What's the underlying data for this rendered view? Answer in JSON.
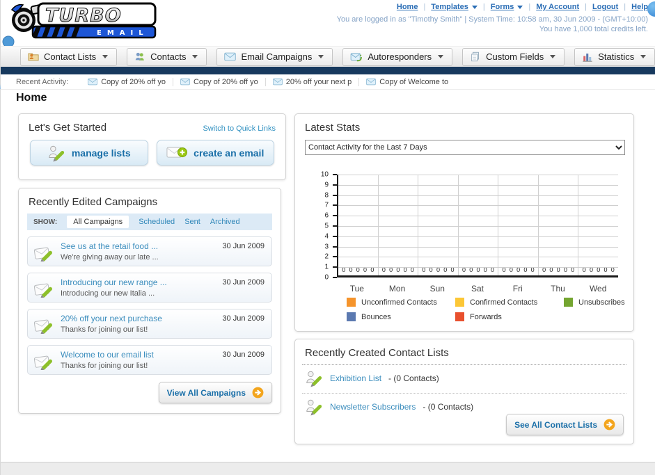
{
  "header": {
    "logo": {
      "title": "TURBO",
      "subtitle": "EMAIL"
    },
    "nav_links": [
      {
        "label": "Home"
      },
      {
        "label": "Templates",
        "dropdown": true
      },
      {
        "label": "Forms",
        "dropdown": true
      },
      {
        "label": "My Account"
      },
      {
        "label": "Logout"
      },
      {
        "label": "Help"
      }
    ],
    "login_info": "You are logged in as \"Timothy Smith\" | System Time: 10:58 am, 30 Jun 2009 - (GMT+10:00)",
    "credits_info": "You have 1,000 total credits left."
  },
  "nav_tabs": [
    {
      "label": "Contact Lists"
    },
    {
      "label": "Contacts"
    },
    {
      "label": "Email Campaigns"
    },
    {
      "label": "Autoresponders"
    },
    {
      "label": "Custom Fields"
    },
    {
      "label": "Statistics"
    }
  ],
  "recent_activity": {
    "label": "Recent Activity:",
    "items": [
      {
        "text": "Copy of 20% off yo"
      },
      {
        "text": "Copy of 20% off yo"
      },
      {
        "text": "20% off your next p"
      },
      {
        "text": "Copy of Welcome to"
      }
    ]
  },
  "page_title": "Home",
  "get_started": {
    "title": "Let's Get Started",
    "switch_link": "Switch to Quick Links",
    "manage_lists_label": "manage lists",
    "create_email_label": "create an email"
  },
  "campaigns": {
    "title": "Recently Edited Campaigns",
    "filter_label": "SHOW:",
    "filters": [
      "All Campaigns",
      "Scheduled",
      "Sent",
      "Archived"
    ],
    "active_filter": "All Campaigns",
    "items": [
      {
        "title": "See us at the retail food ...",
        "subtitle": "We're giving away our late ...",
        "date": "30 Jun 2009"
      },
      {
        "title": "Introducing our new range ...",
        "subtitle": "Introducing our new Italia ...",
        "date": "30 Jun 2009"
      },
      {
        "title": "20% off your next purchase",
        "subtitle": "Thanks for joining our list!",
        "date": "30 Jun 2009"
      },
      {
        "title": "Welcome to our email list",
        "subtitle": "Thanks for joining our list!",
        "date": "30 Jun 2009"
      }
    ],
    "view_all_label": "View All Campaigns"
  },
  "stats": {
    "title": "Latest Stats",
    "dropdown_value": "Contact Activity for the Last 7 Days"
  },
  "chart_data": {
    "type": "bar",
    "title": "Contact Activity for the Last 7 Days",
    "categories": [
      "Tue",
      "Mon",
      "Sun",
      "Sat",
      "Fri",
      "Thu",
      "Wed"
    ],
    "series": [
      {
        "name": "Unconfirmed Contacts",
        "color": "#f5942c",
        "values": [
          0,
          0,
          0,
          0,
          0,
          0,
          0
        ]
      },
      {
        "name": "Confirmed Contacts",
        "color": "#fcc736",
        "values": [
          0,
          0,
          0,
          0,
          0,
          0,
          0
        ]
      },
      {
        "name": "Unsubscribes",
        "color": "#74a530",
        "values": [
          0,
          0,
          0,
          0,
          0,
          0,
          0
        ]
      },
      {
        "name": "Bounces",
        "color": "#5b79b0",
        "values": [
          0,
          0,
          0,
          0,
          0,
          0,
          0
        ]
      },
      {
        "name": "Forwards",
        "color": "#e8502e",
        "values": [
          0,
          0,
          0,
          0,
          0,
          0,
          0
        ]
      }
    ],
    "ylim": [
      0,
      10
    ],
    "ytick_step": 1,
    "grid": true,
    "legend_position": "bottom",
    "value_labels_shown": true
  },
  "contact_lists": {
    "title": "Recently Created Contact Lists",
    "items": [
      {
        "name": "Exhibition List",
        "suffix": "- (0 Contacts)"
      },
      {
        "name": "Newsletter Subscribers",
        "suffix": "- (0 Contacts)"
      }
    ],
    "see_all_label": "See All Contact Lists"
  }
}
